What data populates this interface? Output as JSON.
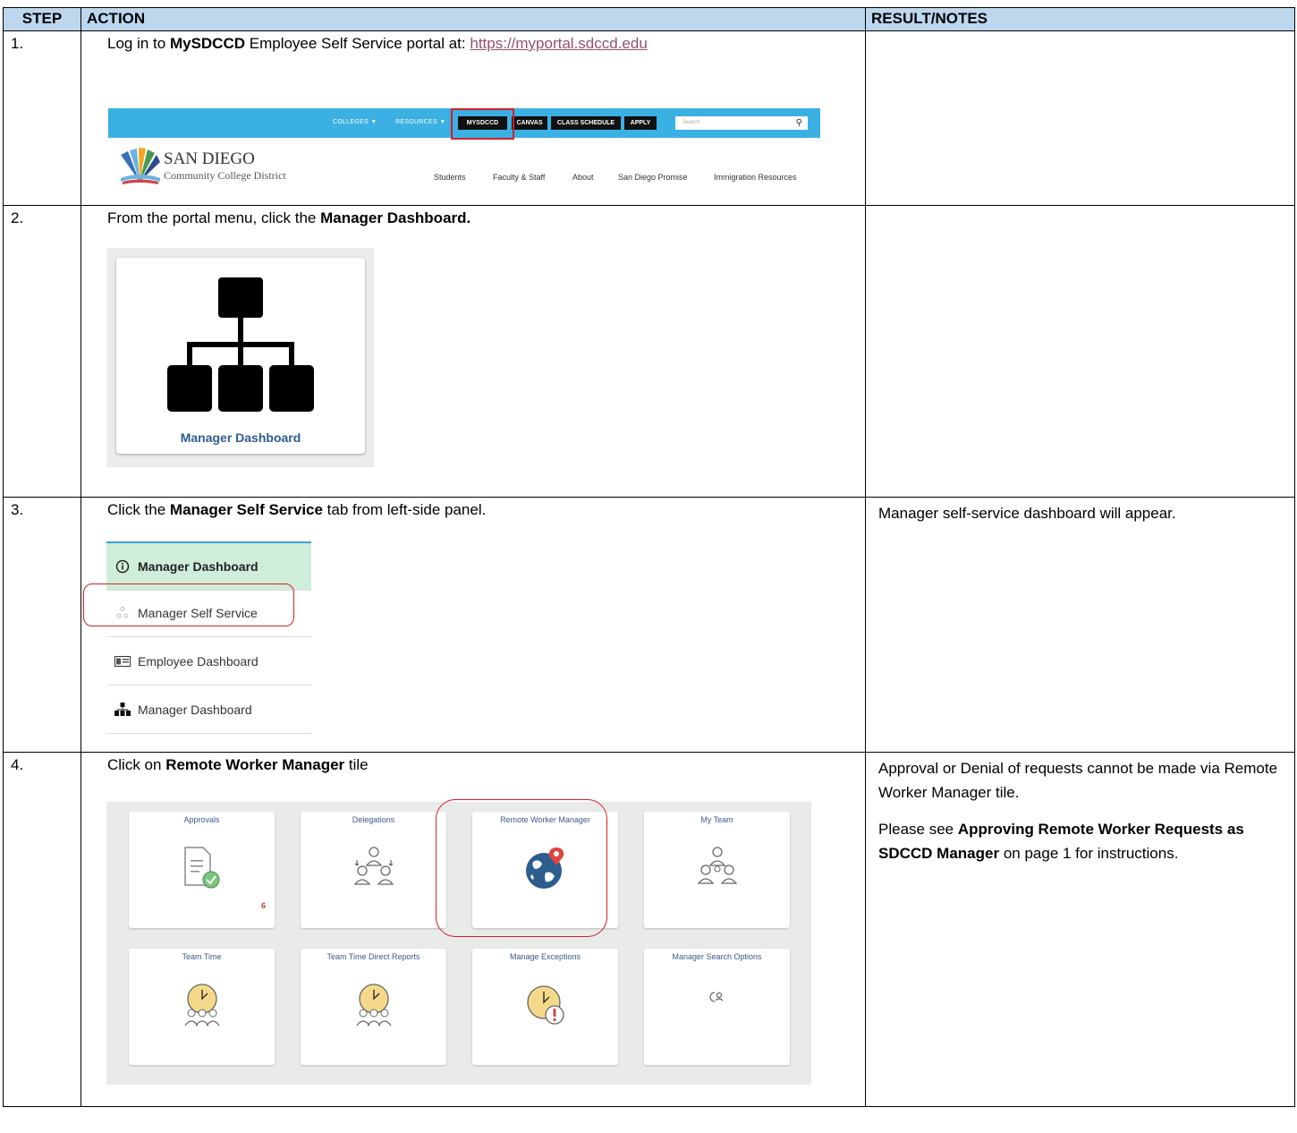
{
  "header": {
    "step": "STEP",
    "action": "ACTION",
    "result": "RESULT/NOTES"
  },
  "steps": [
    {
      "num": "1.",
      "text_prefix": "Log in to ",
      "text_bold": "MySDCCD",
      "text_suffix": " Employee Self Service portal at: ",
      "link": "https://myportal.sdccd.edu",
      "result": "",
      "site": {
        "nav": [
          "COLLEGES ▼",
          "RESOURCES ▼"
        ],
        "buttons": [
          "MYSDCCD",
          "CANVAS",
          "CLASS SCHEDULE",
          "APPLY"
        ],
        "search_placeholder": "Search",
        "logo_name": "SAN DIEGO",
        "logo_sub": "Community College District",
        "links": [
          "Students",
          "Faculty & Staff",
          "About",
          "San Diego Promise",
          "Immigration Resources"
        ]
      }
    },
    {
      "num": "2.",
      "text_prefix": "From the portal menu, click the ",
      "text_bold": "Manager Dashboard.",
      "result": "",
      "tile_label": "Manager Dashboard"
    },
    {
      "num": "3.",
      "text_prefix": "Click the ",
      "text_bold": "Manager Self Service",
      "text_suffix": " tab from left-side panel.",
      "result": "Manager self-service dashboard will appear.",
      "panel_items": [
        "Manager Dashboard",
        "Manager Self Service",
        "Employee Dashboard",
        "Manager Dashboard"
      ]
    },
    {
      "num": "4.",
      "text_prefix": "Click on ",
      "text_bold": "Remote Worker Manager",
      "text_suffix": " tile",
      "result_line1": "Approval or Denial of requests cannot be made via Remote Worker Manager tile.",
      "result_p2_prefix": "Please see ",
      "result_p2_bold": "Approving Remote Worker Requests as SDCCD Manager",
      "result_p2_suffix": " on page 1 for instructions.",
      "tiles": [
        {
          "title": "Approvals",
          "icon": "document-check-icon",
          "count": "6"
        },
        {
          "title": "Delegations",
          "icon": "delegation-people-icon"
        },
        {
          "title": "Remote Worker Manager",
          "icon": "globe-pin-icon"
        },
        {
          "title": "My Team",
          "icon": "team-people-icon"
        },
        {
          "title": "Team Time",
          "icon": "clock-people-icon"
        },
        {
          "title": "Team Time Direct Reports",
          "icon": "clock-people-icon"
        },
        {
          "title": "Manage Exceptions",
          "icon": "clock-alert-icon"
        },
        {
          "title": "Manager Search Options",
          "icon": "search-person-icon"
        }
      ]
    }
  ],
  "colors": {
    "header_bg": "#bdd7ee",
    "link": "#954f72",
    "site_bar": "#3bb0e3",
    "highlight_red": "#d32026",
    "tile_title": "#3c5a88"
  }
}
